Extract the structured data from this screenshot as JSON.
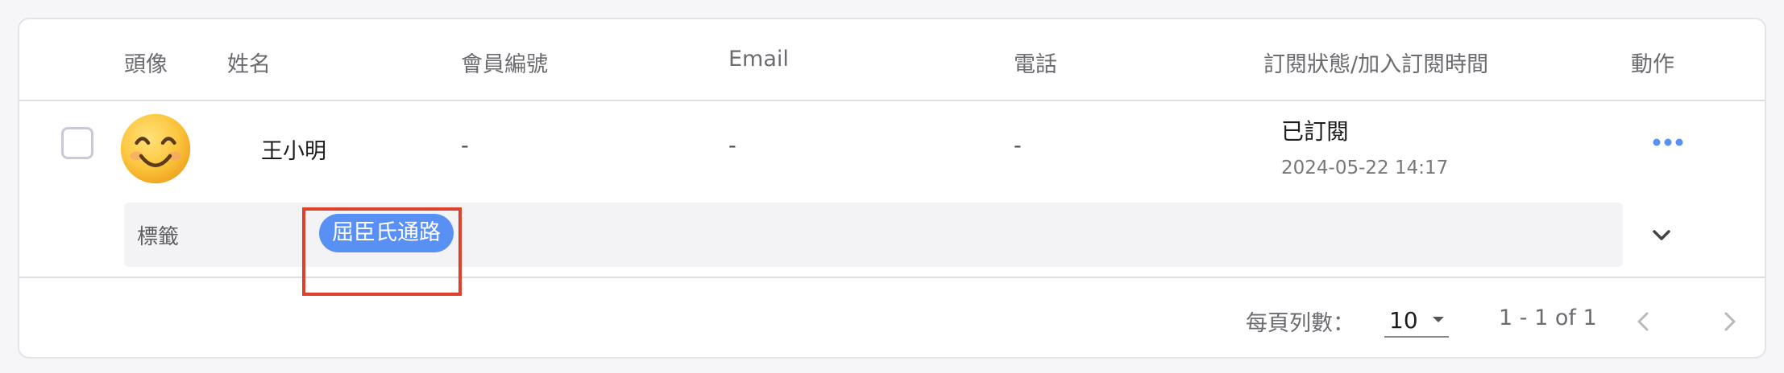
{
  "table": {
    "headers": {
      "avatar": "頭像",
      "name": "姓名",
      "member_id": "會員編號",
      "email": "Email",
      "phone": "電話",
      "subscription": "訂閱狀態/加入訂閱時間",
      "actions": "動作"
    },
    "rows": [
      {
        "avatar_icon": "smiling-face-emoji",
        "name": "王小明",
        "member_id": "-",
        "email": "-",
        "phone": "-",
        "status": "已訂閱",
        "joined_at": "2024-05-22 14:17",
        "actions_icon": "more-horizontal-icon",
        "tags_label": "標籤",
        "tags": [
          "屈臣氏通路"
        ],
        "expand_icon": "chevron-down-icon"
      }
    ]
  },
  "pagination": {
    "rows_per_page_label": "每頁列數：",
    "rows_per_page_value": "10",
    "range_text": "1 - 1 of 1"
  },
  "colors": {
    "accent": "#5890f4",
    "highlight": "#e0402a"
  }
}
